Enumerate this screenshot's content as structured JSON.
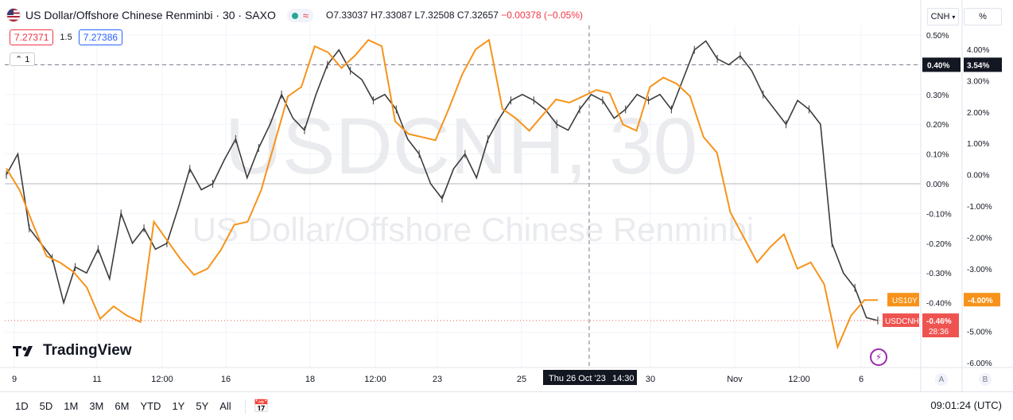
{
  "header": {
    "title": "US Dollar/Offshore Chinese Renminbi · 30 · SAXO",
    "open": "O7.33037",
    "high": "H7.33087",
    "low": "L7.32508",
    "close": "C7.32657",
    "change": "−0.00378 (−0.05%)",
    "bid": "7.27371",
    "spread": "1.5",
    "ask": "7.27386",
    "collapse_count": "1"
  },
  "watermark": {
    "symbol": "USDCNH, 30",
    "name": "US Dollar/Offshore Chinese Renminbi"
  },
  "logo": "TradingView",
  "axis": {
    "currency": "CNH",
    "percent_btn": "%",
    "scale_a": "A",
    "scale_b": "B",
    "left_ticks": [
      "0.50%",
      "0.40%",
      "0.30%",
      "0.20%",
      "0.10%",
      "0.00%",
      "-0.10%",
      "-0.20%",
      "-0.30%",
      "-0.40%",
      "-0.50%"
    ],
    "right_ticks": [
      "4.00%",
      "3.00%",
      "2.00%",
      "1.00%",
      "0.00%",
      "-1.00%",
      "-2.00%",
      "-3.00%",
      "-4.00%",
      "-5.00%",
      "-6.00%"
    ],
    "x_ticks": [
      "9",
      "11",
      "12:00",
      "16",
      "18",
      "12:00",
      "23",
      "25",
      "30",
      "Nov",
      "12:00",
      "6"
    ],
    "crosshair_date": "Thu 26 Oct '23",
    "crosshair_time": "14:30",
    "crosshair_left": "0.40%",
    "crosshair_right": "3.54%"
  },
  "badges": {
    "us10y_label": "US10Y",
    "us10y_value": "-4.00%",
    "usdcnh_label": "USDCNH",
    "usdcnh_value": "-0.46%",
    "countdown": "28:36"
  },
  "toolbar": {
    "timeframes": [
      "1D",
      "5D",
      "1M",
      "3M",
      "6M",
      "YTD",
      "1Y",
      "5Y",
      "All"
    ],
    "clock": "09:01:24 (UTC)"
  },
  "colors": {
    "up": "#26a69a",
    "down": "#f23645",
    "candle": "#3c3c3c",
    "us10y": "#f7931a",
    "usdcnh": "#ef5350"
  },
  "chart_data": {
    "type": "line",
    "series": [
      {
        "name": "USDCNH",
        "axis": "left",
        "values": [
          0.03,
          0.1,
          -0.15,
          -0.2,
          -0.25,
          -0.4,
          -0.28,
          -0.3,
          -0.22,
          -0.32,
          -0.1,
          -0.2,
          -0.15,
          -0.22,
          -0.2,
          -0.08,
          0.05,
          -0.02,
          0.0,
          0.08,
          0.15,
          0.02,
          0.12,
          0.2,
          0.3,
          0.22,
          0.18,
          0.3,
          0.4,
          0.45,
          0.38,
          0.35,
          0.28,
          0.3,
          0.25,
          0.15,
          0.1,
          0.0,
          -0.05,
          0.05,
          0.1,
          0.02,
          0.15,
          0.22,
          0.28,
          0.3,
          0.28,
          0.25,
          0.2,
          0.18,
          0.25,
          0.3,
          0.28,
          0.22,
          0.25,
          0.3,
          0.28,
          0.3,
          0.25,
          0.35,
          0.45,
          0.48,
          0.42,
          0.4,
          0.43,
          0.38,
          0.3,
          0.25,
          0.2,
          0.28,
          0.25,
          0.2,
          -0.2,
          -0.3,
          -0.35,
          -0.45,
          -0.46
        ]
      },
      {
        "name": "US10Y",
        "axis": "right",
        "values": [
          0.2,
          -0.5,
          -1.6,
          -2.6,
          -2.8,
          -3.1,
          -3.6,
          -4.6,
          -4.2,
          -4.5,
          -4.7,
          -1.5,
          -2.1,
          -2.7,
          -3.2,
          -3.0,
          -2.4,
          -1.6,
          -1.5,
          -0.5,
          1.0,
          2.5,
          2.8,
          4.1,
          3.9,
          3.4,
          3.8,
          4.3,
          4.1,
          1.7,
          1.3,
          1.2,
          1.1,
          2.1,
          3.2,
          4.0,
          4.3,
          2.1,
          1.8,
          1.4,
          1.9,
          2.4,
          2.3,
          2.5,
          2.7,
          2.6,
          1.6,
          1.4,
          2.8,
          3.1,
          2.9,
          2.5,
          1.2,
          0.7,
          -1.2,
          -2.0,
          -2.8,
          -2.3,
          -1.9,
          -3.0,
          -2.8,
          -3.5,
          -5.5,
          -4.5,
          -4.0,
          -4.0
        ]
      }
    ],
    "x_labels": [
      "9",
      "11",
      "12:00",
      "16",
      "18",
      "12:00",
      "23",
      "25",
      "30",
      "Nov",
      "12:00",
      "6"
    ],
    "ylim_left": [
      -0.5,
      0.5
    ],
    "ylim_right": [
      -6.0,
      4.0
    ],
    "grid": true,
    "crosshair": {
      "date": "Thu 26 Oct '23",
      "time": "14:30",
      "left": 0.4,
      "right": 3.54
    }
  }
}
